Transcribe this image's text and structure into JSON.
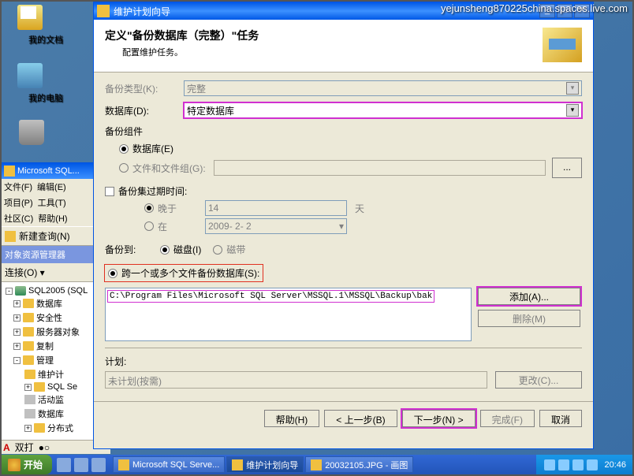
{
  "watermark": "yejunsheng870225china.spaces.live.com",
  "desktop": {
    "documents": "我的文档",
    "computer": "我的电脑"
  },
  "ssms": {
    "title": "Microsoft SQL...",
    "menu": {
      "file": "文件(F)",
      "edit": "编辑(E)",
      "project": "项目(P)",
      "tools": "工具(T)",
      "community": "社区(C)",
      "help": "帮助(H)"
    },
    "new_query": "新建查询(N)",
    "pane_title": "对象资源管理器",
    "connect": "连接(O) ▾",
    "tree": {
      "root": "SQL2005 (SQL",
      "databases": "数据库",
      "security": "安全性",
      "server_obj": "服务器对象",
      "replication": "复制",
      "management": "管理",
      "maint_plan": "维护计",
      "sql_se": "SQL Se",
      "activity": "活动监",
      "db_mail": "数据库",
      "distributed": "分布式"
    },
    "status": "双打"
  },
  "wizard": {
    "title": "维护计划向导",
    "heading": "定义\"备份数据库（完整）\"任务",
    "subheading": "配置维护任务。",
    "backup_type_lbl": "备份类型(K):",
    "backup_type_val": "完整",
    "database_lbl": "数据库(D):",
    "database_val": "特定数据库",
    "component_lbl": "备份组件",
    "comp_db": "数据库(E)",
    "comp_files": "文件和文件组(G):",
    "expire_lbl": "备份集过期时间:",
    "expire_after": "晚于",
    "expire_on": "在",
    "expire_days_val": "14",
    "expire_days_suffix": "天",
    "expire_date_val": "2009- 2- 2",
    "backup_to_lbl": "备份到:",
    "to_disk": "磁盘(I)",
    "to_tape": "磁带",
    "across_files": "跨一个或多个文件备份数据库(S):",
    "file_path": "C:\\Program Files\\Microsoft SQL Server\\MSSQL.1\\MSSQL\\Backup\\bak",
    "add_btn": "添加(A)...",
    "remove_btn": "删除(M)",
    "plan_lbl": "计划:",
    "plan_val": "未计划(按需)",
    "change_btn": "更改(C)...",
    "help_btn": "帮助(H)",
    "back_btn": "< 上一步(B)",
    "next_btn": "下一步(N) >",
    "finish_btn": "完成(F)",
    "cancel_btn": "取消",
    "dots": "..."
  },
  "taskbar": {
    "start": "开始",
    "t1": "Microsoft SQL Serve...",
    "t2": "维护计划向导",
    "t3": "20032105.JPG - 画图",
    "time": "20:46"
  }
}
